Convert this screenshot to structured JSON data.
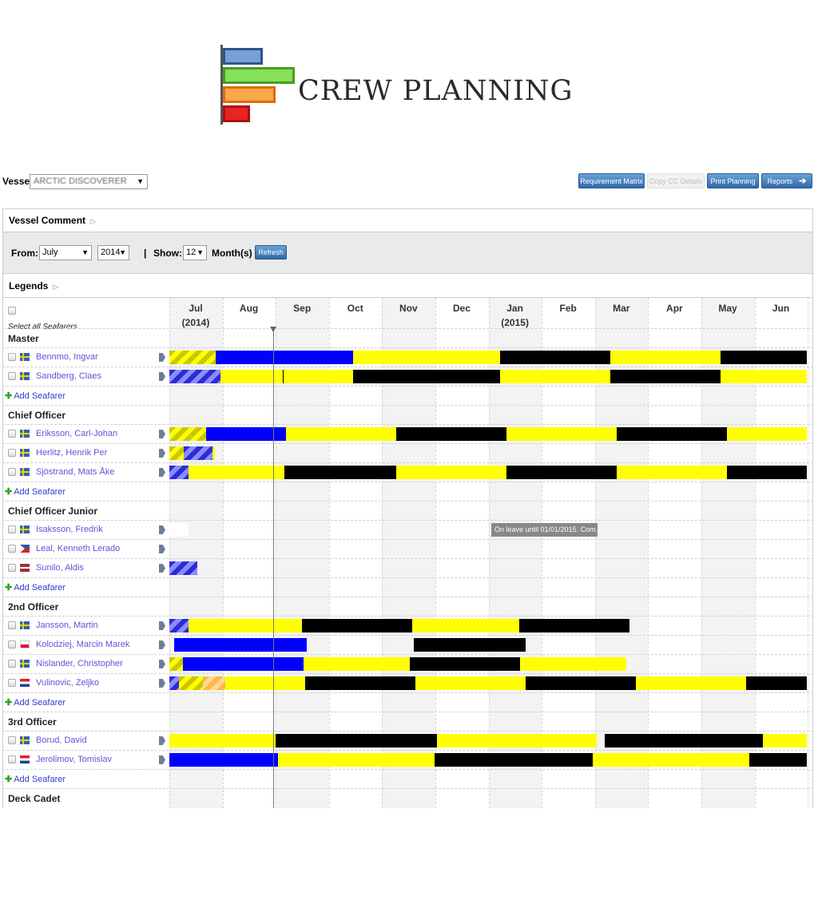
{
  "app": {
    "title": "CREW PLANNING"
  },
  "toolbar": {
    "vessel_label": "Vessel:",
    "vessel_value": "ARCTIC DISCOVERER",
    "requirement_matrix": "Requirement Matrix",
    "copy_cc_details": "Copy CC Details",
    "print_planning": "Print Planning",
    "reports": "Reports"
  },
  "panels": {
    "vessel_comment": "Vessel Comment",
    "legends": "Legends"
  },
  "filters": {
    "from_label": "From:",
    "month_value": "July",
    "year_value": "2014",
    "separator": "|",
    "show_label": "Show:",
    "show_value": "12",
    "unit_label": "Month(s)",
    "refresh": "Refresh"
  },
  "timeline": {
    "months": [
      "Jul",
      "Aug",
      "Sep",
      "Oct",
      "Nov",
      "Dec",
      "Jan",
      "Feb",
      "Mar",
      "Apr",
      "May",
      "Jun"
    ],
    "year_start": "(2014)",
    "year_next": "(2015)",
    "select_all": "Select all Seafarers",
    "add_seafarer": "Add Seafarer",
    "tooltip": "On leave until 01/01/2015. Com..."
  },
  "colors": {
    "onboard": "#0000ff",
    "planned": "#ffff00",
    "leave": "#000000",
    "buttons": "#2f6aa8"
  },
  "groups": [
    {
      "title": "Master",
      "seafarers": [
        {
          "name": "Bennmo, Ingvar",
          "flag": "se"
        },
        {
          "name": "Sandberg, Claes",
          "flag": "se"
        }
      ]
    },
    {
      "title": "Chief Officer",
      "seafarers": [
        {
          "name": "Eriksson, Carl-Johan",
          "flag": "se"
        },
        {
          "name": "Herlitz, Henrik Per",
          "flag": "se"
        },
        {
          "name": "Sjöstrand, Mats Åke",
          "flag": "se"
        }
      ]
    },
    {
      "title": "Chief Officer Junior",
      "seafarers": [
        {
          "name": "Isaksson, Fredrik",
          "flag": "se"
        },
        {
          "name": "Leal, Kenneth Lerado",
          "flag": "ph"
        },
        {
          "name": "Sunilo, Aldis",
          "flag": "lv"
        }
      ]
    },
    {
      "title": "2nd Officer",
      "seafarers": [
        {
          "name": "Jansson, Martin",
          "flag": "se"
        },
        {
          "name": "Kolodziej, Marcin Marek",
          "flag": "pl"
        },
        {
          "name": "Nislander, Christopher",
          "flag": "se"
        },
        {
          "name": "Vulinovic, Zeljko",
          "flag": "hr"
        }
      ]
    },
    {
      "title": "3rd Officer",
      "seafarers": [
        {
          "name": "Borud, David",
          "flag": "se"
        },
        {
          "name": "Jerolimov, Tomislav",
          "flag": "hr"
        }
      ]
    },
    {
      "title": "Deck Cadet",
      "seafarers": []
    }
  ]
}
